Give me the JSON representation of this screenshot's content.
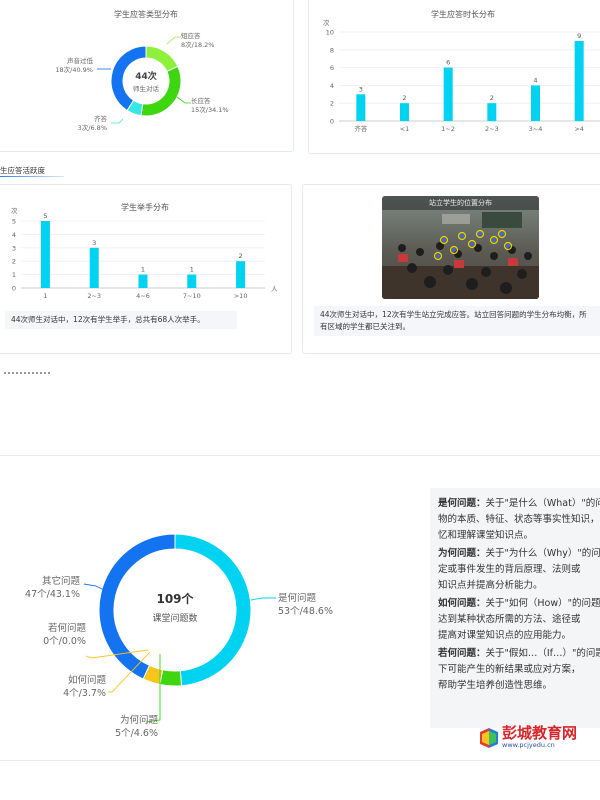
{
  "answer_type_chart": {
    "title": "学生应答类型分布",
    "center_value": "44次",
    "center_label": "师生对话",
    "labels": [
      {
        "line1": "短应答",
        "line2": "8次/18.2%"
      },
      {
        "line1": "长应答",
        "line2": "15次/34.1%"
      },
      {
        "line1": "齐答",
        "line2": "3次/6.8%"
      },
      {
        "line1": "声音过低",
        "line2": "18次/40.9%"
      }
    ]
  },
  "answer_duration_chart": {
    "title": "学生应答时长分布",
    "ylabel": "次",
    "yticks": [
      "0",
      "2",
      "4",
      "6",
      "8",
      "10"
    ]
  },
  "section_activity": {
    "label": "生应答活跃度"
  },
  "hand_raise_chart": {
    "title": "学生举手分布",
    "ylabel": "次",
    "xlabel": "人",
    "yticks": [
      "0",
      "1",
      "2",
      "3",
      "4",
      "5"
    ],
    "note": "44次师生对话中，12次有学生举手，总共有68人次举手。"
  },
  "seat_map": {
    "title": "站立学生的位置分布",
    "note_line1": "44次师生对话中，12次有学生站立完成应答。站立回答问题的学生分布均衡，所",
    "note_line2": "有区域的学生都已关注到。"
  },
  "question_chart": {
    "center_value": "109个",
    "center_label": "课堂问题数",
    "labels": [
      {
        "line1": "是何问题",
        "line2": "53个/48.6%"
      },
      {
        "line1": "其它问题",
        "line2": "47个/43.1%"
      },
      {
        "line1": "若何问题",
        "line2": "0个/0.0%"
      },
      {
        "line1": "如何问题",
        "line2": "4个/3.7%"
      },
      {
        "line1": "为何问题",
        "line2": "5个/4.6%"
      }
    ]
  },
  "question_desc": [
    {
      "term": "是何问题：",
      "lines": [
        "关于\"是什么（What）\"的问题，",
        "物的本质、特征、状态等事实性知识，",
        "忆和理解课堂知识点。"
      ]
    },
    {
      "term": "为何问题：",
      "lines": [
        "关于\"为什么（Why）\"的问题，",
        "定或事件发生的背后原理、法则或",
        "知识点并提高分析能力。"
      ]
    },
    {
      "term": "如何问题：",
      "lines": [
        "关于\"如何（How）\"的问题，",
        "达到某种状态所需的方法、途径或",
        "提高对课堂知识点的应用能力。"
      ]
    },
    {
      "term": "若何问题：",
      "lines": [
        "关于\"假如…（If…）\"的问题，",
        "下可能产生的新结果或应对方案，",
        "帮助学生培养创造性思维。"
      ]
    }
  ],
  "logo": {
    "name": "彭城教育网",
    "url": "www.pcjyedu.cn"
  },
  "colors": {
    "cyan": "#00d2f2",
    "blue": "#1373f0",
    "green": "#3ed60f",
    "lime": "#8df03a",
    "yellow": "#f7c51e"
  },
  "chart_data": [
    {
      "type": "pie",
      "title": "学生应答类型分布",
      "categories": [
        "短应答",
        "长应答",
        "齐答",
        "声音过低"
      ],
      "values": [
        8,
        15,
        3,
        18
      ],
      "colors": [
        "#8df03a",
        "#3ed60f",
        "#39e6e6",
        "#1373f0"
      ]
    },
    {
      "type": "bar",
      "title": "学生应答时长分布",
      "categories": [
        "齐答",
        "<1",
        "1~2",
        "2~3",
        "3~4",
        ">4"
      ],
      "values": [
        3,
        2,
        6,
        2,
        4,
        9
      ],
      "ylabel": "次",
      "ylim": [
        0,
        10
      ]
    },
    {
      "type": "bar",
      "title": "学生举手分布",
      "categories": [
        "1",
        "2~3",
        "4~6",
        "7~10",
        ">10"
      ],
      "values": [
        5,
        3,
        1,
        1,
        2
      ],
      "ylabel": "次",
      "xlabel": "人",
      "ylim": [
        0,
        5
      ]
    },
    {
      "type": "pie",
      "categories": [
        "是何问题",
        "为何问题",
        "如何问题",
        "若何问题",
        "其它问题"
      ],
      "values": [
        53,
        5,
        4,
        0,
        47
      ],
      "colors": [
        "#00d2f2",
        "#3ed60f",
        "#f7c51e",
        "#f7c51e",
        "#1373f0"
      ]
    }
  ]
}
